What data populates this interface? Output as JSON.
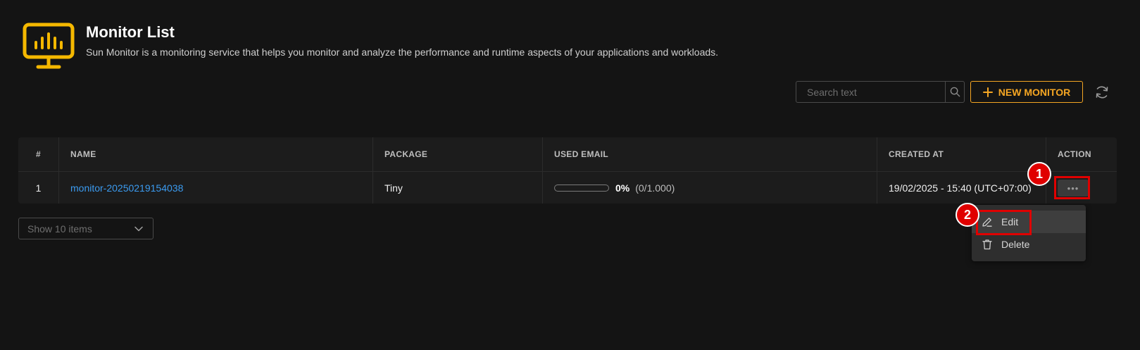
{
  "header": {
    "title": "Monitor List",
    "subtitle": "Sun Monitor is a monitoring service that helps you monitor and analyze the performance and runtime aspects of your applications and workloads.",
    "logo_icon": "monitor-chart-icon",
    "accent_color": "#f5b800"
  },
  "toolbar": {
    "search_placeholder": "Search text",
    "search_icon": "search-icon",
    "new_monitor_label": "NEW MONITOR",
    "new_monitor_icon": "plus-icon",
    "refresh_icon": "refresh-icon",
    "accent_color": "#f5a623"
  },
  "table": {
    "columns": [
      "#",
      "NAME",
      "PACKAGE",
      "USED EMAIL",
      "CREATED AT",
      "ACTION"
    ],
    "rows": [
      {
        "index": "1",
        "name": "monitor-2025021915403​8",
        "package": "Tiny",
        "used_email_percent_label": "0%",
        "used_email_ratio": "(0/1.000)",
        "used_email_fraction": 0,
        "created_at": "19/02/2025 - 15:40 (UTC+07:00)",
        "action_label": "•••"
      }
    ]
  },
  "pager": {
    "page_size_label": "Show 10 items",
    "chevron_icon": "chevron-down-icon"
  },
  "action_menu": {
    "items": [
      {
        "label": "Edit",
        "icon": "pencil-icon"
      },
      {
        "label": "Delete",
        "icon": "trash-icon"
      }
    ]
  },
  "annotations": {
    "step_1": "1",
    "step_2": "2",
    "marker_color": "#e00000"
  }
}
